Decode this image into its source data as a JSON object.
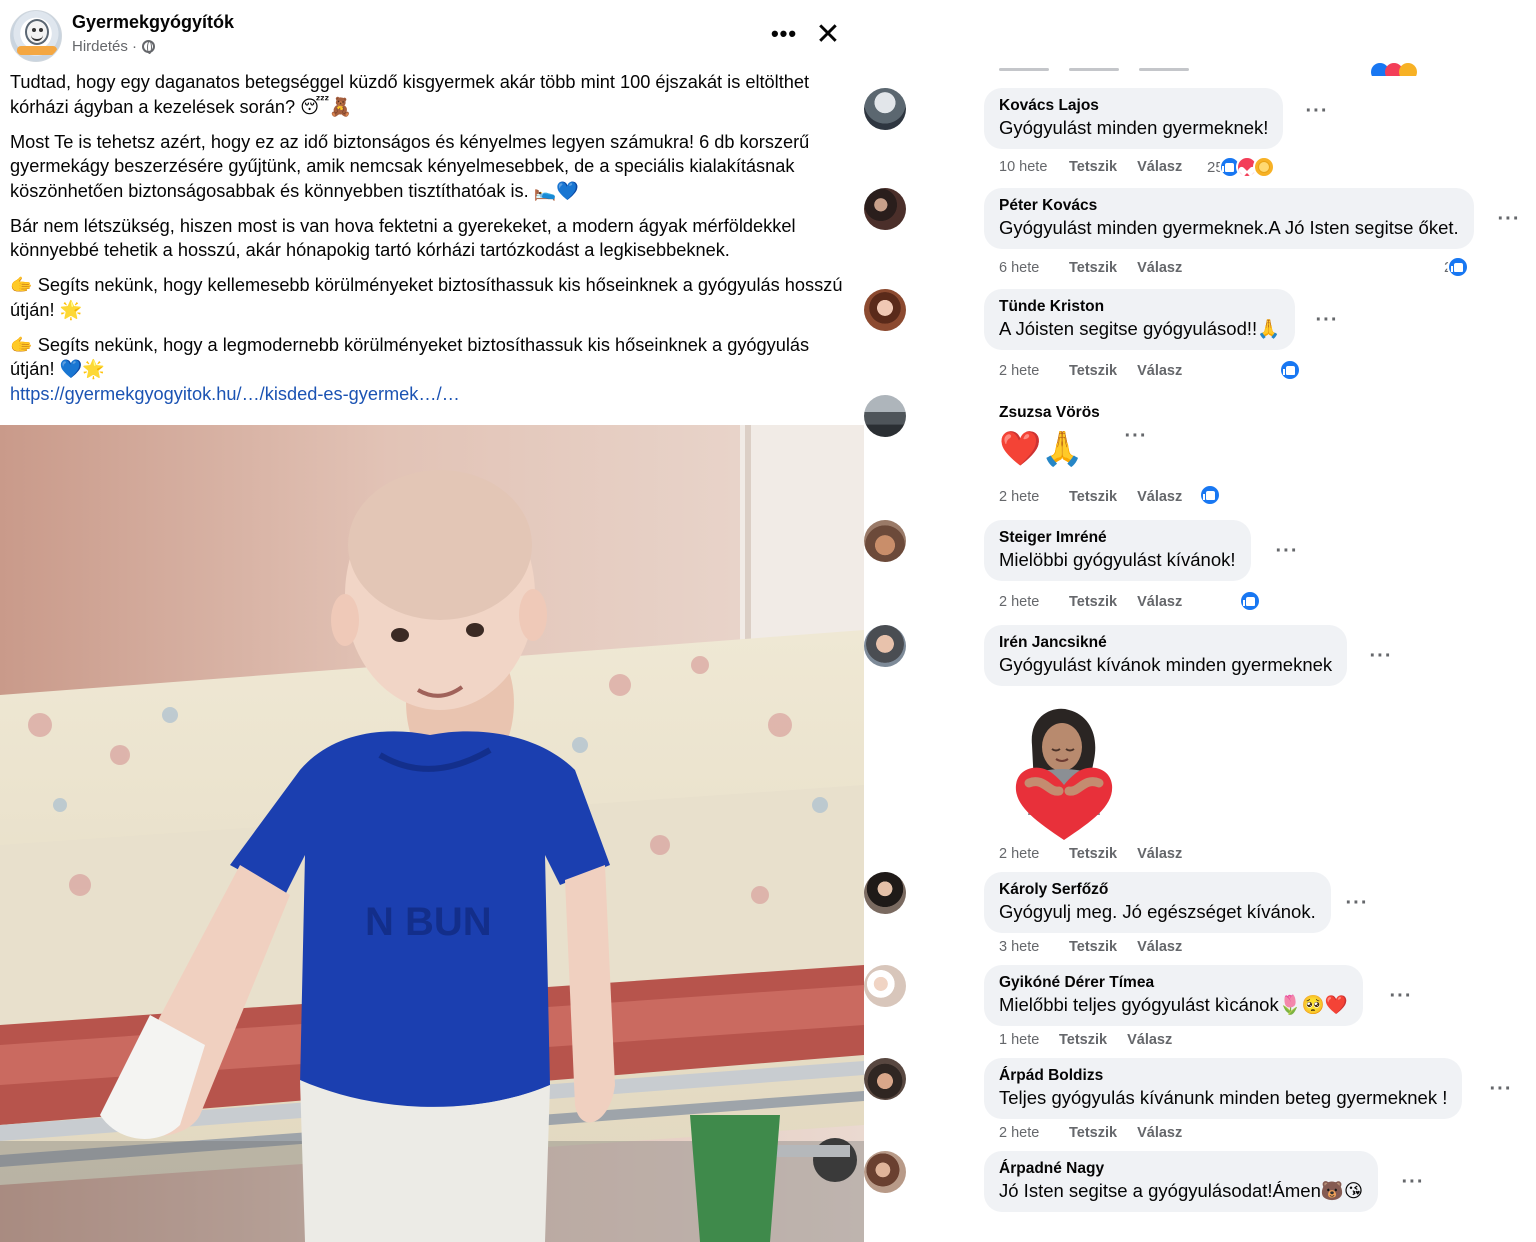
{
  "post": {
    "page_name": "Gyermekgyógyítók",
    "sponsored_label": "Hirdetés ·",
    "more_label": "•••",
    "close_label": "✕",
    "paragraphs": [
      "Tudtad, hogy egy daganatos betegséggel küzdő kisgyermek akár több mint 100 éjszakát is eltölthet kórházi ágyban a kezelések során? 😴🧸",
      "Most Te is tehetsz azért, hogy ez az idő biztonságos és kényelmes legyen számukra! 6 db korszerű gyermekágy beszerzésére gyűjtünk, amik nemcsak kényelmesebbek, de a speciális kialakításnak köszönhetően biztonságosabbak és könnyebben tisztíthatóak is. 🛌💙",
      "Bár nem létszükség, hiszen most is van hova fektetni a gyerekeket, a modern ágyak mérföldekkel könnyebbé tehetik a hosszú, akár hónapokig tartó kórházi tartózkodást a legkisebbeknek.",
      "🫱 Segíts nekünk, hogy kellemesebb körülményeket biztosíthassuk kis hőseinknek a gyógyulás hosszú útján! 🌟",
      "🫱 Segíts nekünk, hogy a legmodernebb körülményeket biztosíthassuk kis hőseinknek a gyógyulás útján! 💙🌟"
    ],
    "link_text": "https://gyermekgyogyitok.hu/…/kisded-es-gyermek…/…"
  },
  "comments": [
    {
      "name": "Kovács Lajos",
      "text": "Gyógyulást minden gyermeknek!",
      "time": "10 hete",
      "like": "Tetszik",
      "reply": "Válasz",
      "reaction_count": "25",
      "reactions": [
        "like",
        "love",
        "care"
      ]
    },
    {
      "name": "Péter Kovács",
      "text": "Gyógyulást minden gyermeknek.A Jó Isten segitse őket.",
      "time": "6 hete",
      "like": "Tetszik",
      "reply": "Válasz",
      "reaction_count": "2",
      "reactions": [
        "like"
      ]
    },
    {
      "name": "Tünde Kriston",
      "text": "A Jóisten segitse gyógyulásod!!🙏",
      "time": "2 hete",
      "like": "Tetszik",
      "reply": "Válasz",
      "reaction_count": "",
      "reactions": [
        "like"
      ]
    },
    {
      "name": "Zsuzsa Vörös",
      "text": "❤️🙏",
      "time": "2 hete",
      "like": "Tetszik",
      "reply": "Válasz",
      "reaction_count": "",
      "reactions": [
        "like"
      ]
    },
    {
      "name": "Steiger Imréné",
      "text": "Mielöbbi gyógyulást kívánok!",
      "time": "2 hete",
      "like": "Tetszik",
      "reply": "Válasz",
      "reaction_count": "",
      "reactions": [
        "like"
      ]
    },
    {
      "name": "Irén Jancsikné",
      "text": "Gyógyulást kívánok minden gyermeknek",
      "time": "2 hete",
      "like": "Tetszik",
      "reply": "Válasz",
      "reaction_count": "",
      "reactions": [],
      "sticker": "heart-hug-sticker"
    },
    {
      "name": "Károly Serfőző",
      "text": "Gyógyulj meg. Jó egészséget kívánok.",
      "time": "3 hete",
      "like": "Tetszik",
      "reply": "Válasz",
      "reaction_count": "",
      "reactions": []
    },
    {
      "name": "Gyikóné Dérer Tímea",
      "text": "Mielőbbi teljes gyógyulást kìcánok🌷🥺❤️",
      "time": "1 hete",
      "like": "Tetszik",
      "reply": "Válasz",
      "reaction_count": "",
      "reactions": []
    },
    {
      "name": "Árpád Boldizs",
      "text": "Teljes gyógyulás kívánunk minden beteg gyermeknek !",
      "time": "2 hete",
      "like": "Tetszik",
      "reply": "Válasz",
      "reaction_count": "",
      "reactions": []
    },
    {
      "name": "Árpadné Nagy",
      "text": "Jó Isten segitse a gyógyulásodat!Ámen🐻😘",
      "time": "",
      "like": "",
      "reply": "",
      "reaction_count": "",
      "reactions": []
    }
  ],
  "colors": {
    "accent": "#1877f2",
    "link": "#1b53b3",
    "bubble": "#f0f2f5",
    "muted": "#65676b"
  },
  "icons": [
    "globe-icon",
    "more-icon",
    "close-icon",
    "like-reaction-icon",
    "love-reaction-icon",
    "care-reaction-icon"
  ]
}
